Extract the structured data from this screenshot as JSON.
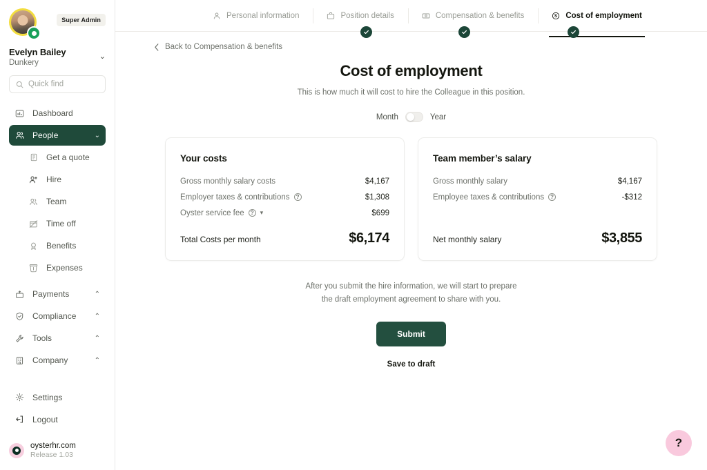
{
  "sidebar": {
    "user": {
      "name": "Evelyn Bailey",
      "org": "Dunkery",
      "role_badge": "Super Admin",
      "chevron": "⌄"
    },
    "search": {
      "placeholder": "Quick find"
    },
    "items": [
      {
        "label": "Dashboard",
        "icon": "dashboard-icon",
        "active": false
      },
      {
        "label": "People",
        "icon": "people-icon",
        "active": true,
        "chevron": "⌄"
      }
    ],
    "people_sub": [
      {
        "label": "Get a quote",
        "icon": "document-icon"
      },
      {
        "label": "Hire",
        "icon": "person-add-icon"
      },
      {
        "label": "Team",
        "icon": "team-icon"
      },
      {
        "label": "Time off",
        "icon": "calendar-off-icon"
      },
      {
        "label": "Benefits",
        "icon": "benefits-icon"
      },
      {
        "label": "Expenses",
        "icon": "expenses-icon"
      }
    ],
    "groups": [
      {
        "label": "Payments",
        "icon": "payments-icon",
        "chevron": "⌃"
      },
      {
        "label": "Compliance",
        "icon": "shield-icon",
        "chevron": "⌃"
      },
      {
        "label": "Tools",
        "icon": "tools-icon",
        "chevron": "⌃"
      },
      {
        "label": "Company",
        "icon": "company-icon",
        "chevron": "⌃"
      }
    ],
    "bottom": [
      {
        "label": "Settings",
        "icon": "gear-icon"
      },
      {
        "label": "Logout",
        "icon": "logout-icon"
      }
    ],
    "brand": {
      "name": "oysterhr.com",
      "release": "Release 1.03"
    }
  },
  "stepper": {
    "steps": [
      {
        "label": "Personal information",
        "icon": "person-icon",
        "state": "complete"
      },
      {
        "label": "Position details",
        "icon": "briefcase-icon",
        "state": "complete"
      },
      {
        "label": "Compensation & benefits",
        "icon": "money-icon",
        "state": "complete"
      },
      {
        "label": "Cost of employment",
        "icon": "dollar-circle-icon",
        "state": "current"
      }
    ]
  },
  "main": {
    "back_label": "Back to Compensation & benefits",
    "title": "Cost of employment",
    "subtitle": "This is how much it will cost to hire the Colleague in this position.",
    "period_toggle": {
      "left": "Month",
      "right": "Year",
      "selected": "Month"
    },
    "cards": [
      {
        "title": "Your costs",
        "rows": [
          {
            "label": "Gross monthly salary costs",
            "value": "$4,167",
            "help": false,
            "dropdown": false
          },
          {
            "label": "Employer taxes & contributions",
            "value": "$1,308",
            "help": true,
            "dropdown": false
          },
          {
            "label": "Oyster service fee",
            "value": "$699",
            "help": true,
            "dropdown": true
          }
        ],
        "total_label": "Total Costs per month",
        "total_value": "$6,174"
      },
      {
        "title": "Team member’s salary",
        "rows": [
          {
            "label": "Gross monthly salary",
            "value": "$4,167",
            "help": false,
            "dropdown": false
          },
          {
            "label": "Employee taxes & contributions",
            "value": "-$312",
            "help": true,
            "dropdown": false
          }
        ],
        "total_label": "Net monthly salary",
        "total_value": "$3,855"
      }
    ],
    "note_line1": "After you submit the hire information, we will start to prepare",
    "note_line2": "the draft employment agreement to share with you.",
    "submit_label": "Submit",
    "save_draft_label": "Save to draft",
    "help_fab_label": "?"
  },
  "colors": {
    "brand_green": "#1f4a3a",
    "button_green": "#234f3f",
    "check_green": "#1c4638",
    "help_pink": "#f9c9dd",
    "badge_bg": "#f2f1ec",
    "avatar_ring": "#f3dd3e",
    "avatar_badge": "#18a05a"
  }
}
